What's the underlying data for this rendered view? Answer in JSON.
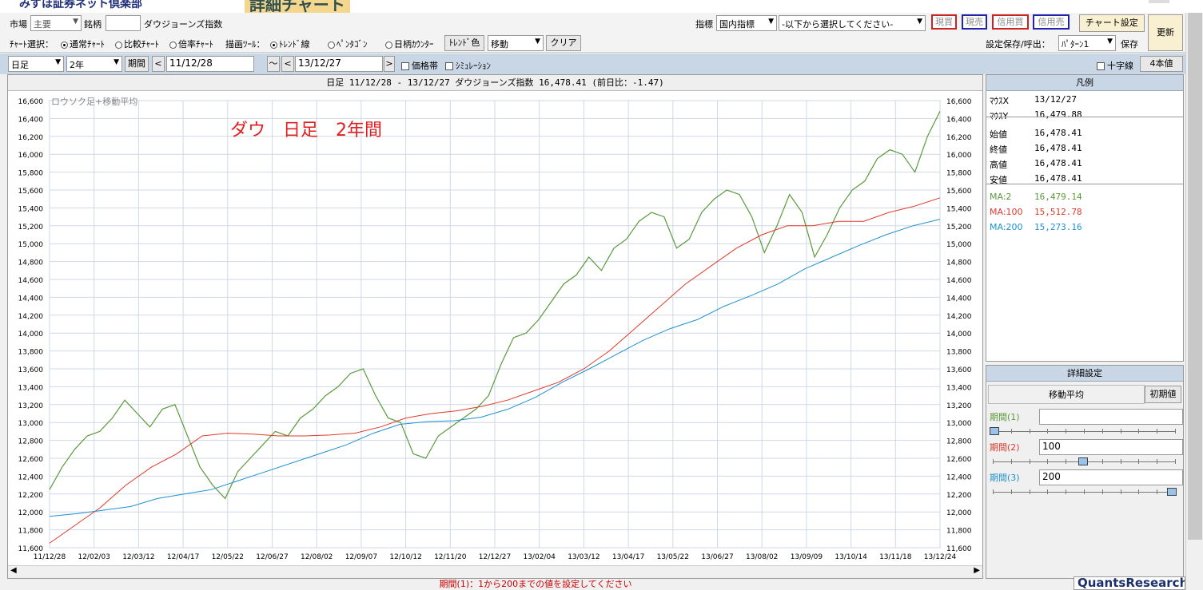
{
  "header": {
    "brand": "みずほ証券ネット倶楽部",
    "title_graphic": "詳細チャート"
  },
  "toolbar": {
    "market_label": "市場",
    "market_value": "主要",
    "symbol_label": "銘柄",
    "symbol_value": "",
    "symbol_name": "ダウジョーンズ指数",
    "indicator_label": "指標",
    "indicator_value": "国内指標",
    "indicator_option": "-以下から選択してください-",
    "order_buttons": [
      "現買",
      "現売",
      "信用買",
      "信用売"
    ],
    "chart_settings": "チャート設定",
    "refresh": "更新",
    "chart_select_label": "ﾁｬｰﾄ選択：",
    "chart_types": [
      "通常ﾁｬｰﾄ",
      "比較ﾁｬｰﾄ",
      "倍率ﾁｬｰﾄ"
    ],
    "draw_tool_label": "描画ﾂｰﾙ：",
    "draw_tools": [
      "ﾄﾚﾝﾄﾞ線",
      "ﾍﾟﾝﾀｺﾞﾝ",
      "日柄ｶｳﾝﾀｰ"
    ],
    "trend_color": "ﾄﾚﾝﾄﾞ色",
    "move_value": "移動",
    "clear": "クリア",
    "save_label": "設定保存/呼出：",
    "pattern_value": "ﾊﾟﾀｰﾝ1",
    "save": "保存"
  },
  "row3": {
    "interval": "日足",
    "period": "2年",
    "period_btn": "期間",
    "prev": "<",
    "start": "11/12/28",
    "tilde": "〜",
    "prev2": "<",
    "end": "13/12/27",
    "next": ">",
    "price_band": "価格帯",
    "simulation": "ｼﾐｭﾚｰｼｮﾝ",
    "crosshair": "十字線",
    "four_values": "4本値"
  },
  "chart": {
    "header": "日足 11/12/28 - 13/12/27  ダウジョーンズ指数  16,478.41 (前日比：-1.47)",
    "subtitle": "ロウソク足+移動平均",
    "annotation": "ダウ　日足　2年間",
    "colors": {
      "price": "#5a9a3a",
      "ma100": "#e03a2a",
      "ma200": "#1e90d0",
      "annotation": "#e02020"
    }
  },
  "chart_data": {
    "type": "line",
    "ylim": [
      11600,
      16600
    ],
    "yticks": [
      "16,600",
      "16,400",
      "16,200",
      "16,000",
      "15,800",
      "15,600",
      "15,400",
      "15,200",
      "15,000",
      "14,800",
      "14,600",
      "14,400",
      "14,200",
      "14,000",
      "13,800",
      "13,600",
      "13,400",
      "13,200",
      "13,000",
      "12,800",
      "12,600",
      "12,400",
      "12,200",
      "12,000",
      "11,800",
      "11,600"
    ],
    "xticks": [
      "11/12/28",
      "12/02/03",
      "12/03/12",
      "12/04/17",
      "12/05/22",
      "12/06/27",
      "12/08/02",
      "12/09/07",
      "12/10/12",
      "12/11/20",
      "12/12/27",
      "13/02/04",
      "13/03/12",
      "13/04/17",
      "13/05/22",
      "13/06/27",
      "13/08/02",
      "13/09/09",
      "13/10/14",
      "13/11/18",
      "13/12/24"
    ],
    "series": [
      {
        "name": "MA:2",
        "values": [
          12250,
          12500,
          12700,
          12850,
          12900,
          13050,
          13250,
          13100,
          12950,
          13150,
          13200,
          12850,
          12500,
          12300,
          12150,
          12450,
          12600,
          12750,
          12900,
          12850,
          13050,
          13150,
          13300,
          13400,
          13550,
          13600,
          13300,
          13050,
          13000,
          12650,
          12600,
          12850,
          12950,
          13050,
          13150,
          13300,
          13650,
          13950,
          14000,
          14150,
          14350,
          14550,
          14650,
          14850,
          14700,
          14950,
          15050,
          15250,
          15350,
          15300,
          14950,
          15050,
          15350,
          15500,
          15600,
          15550,
          15300,
          14900,
          15200,
          15550,
          15350,
          14850,
          15100,
          15400,
          15600,
          15700,
          15950,
          16050,
          16000,
          15800,
          16200,
          16480
        ]
      },
      {
        "name": "MA:100",
        "values": [
          11650,
          11850,
          12050,
          12300,
          12500,
          12650,
          12850,
          12880,
          12870,
          12850,
          12850,
          12860,
          12880,
          12950,
          13050,
          13100,
          13130,
          13180,
          13250,
          13350,
          13450,
          13600,
          13800,
          14050,
          14300,
          14550,
          14750,
          14950,
          15100,
          15200,
          15200,
          15250,
          15250,
          15350,
          15420,
          15512.78
        ]
      },
      {
        "name": "MA:200",
        "values": [
          11950,
          11980,
          12020,
          12060,
          12150,
          12200,
          12250,
          12350,
          12450,
          12550,
          12650,
          12750,
          12880,
          12980,
          13010,
          13020,
          13060,
          13150,
          13280,
          13450,
          13600,
          13760,
          13920,
          14050,
          14150,
          14300,
          14420,
          14550,
          14720,
          14850,
          14980,
          15100,
          15200,
          15273.16
        ]
      }
    ]
  },
  "legend": {
    "title": "凡例",
    "rows": [
      {
        "label": "ﾏｳｽX",
        "value": "13/12/27"
      },
      {
        "label": "ﾏｳｽY",
        "value": "16,479.88"
      },
      {
        "label": "始値",
        "value": "16,478.41"
      },
      {
        "label": "終値",
        "value": "16,478.41"
      },
      {
        "label": "高値",
        "value": "16,478.41"
      },
      {
        "label": "安値",
        "value": "16,478.41"
      }
    ],
    "ma": [
      {
        "label": "MA:2",
        "value": "16,479.14",
        "color": "#5a9a3a"
      },
      {
        "label": "MA:100",
        "value": "15,512.78",
        "color": "#e03a2a"
      },
      {
        "label": "MA:200",
        "value": "15,273.16",
        "color": "#1e90d0"
      }
    ]
  },
  "settings": {
    "title": "詳細設定",
    "ma_label": "移動平均",
    "reset": "初期値",
    "periods": [
      {
        "label": "期間(1)",
        "value": "",
        "color": "#5a9a3a"
      },
      {
        "label": "期間(2)",
        "value": "100",
        "color": "#e03a2a"
      },
      {
        "label": "期間(3)",
        "value": "200",
        "color": "#1e90d0"
      }
    ]
  },
  "status": "期間(1)：1から200までの値を設定してください",
  "quants": "QuantsResearch"
}
